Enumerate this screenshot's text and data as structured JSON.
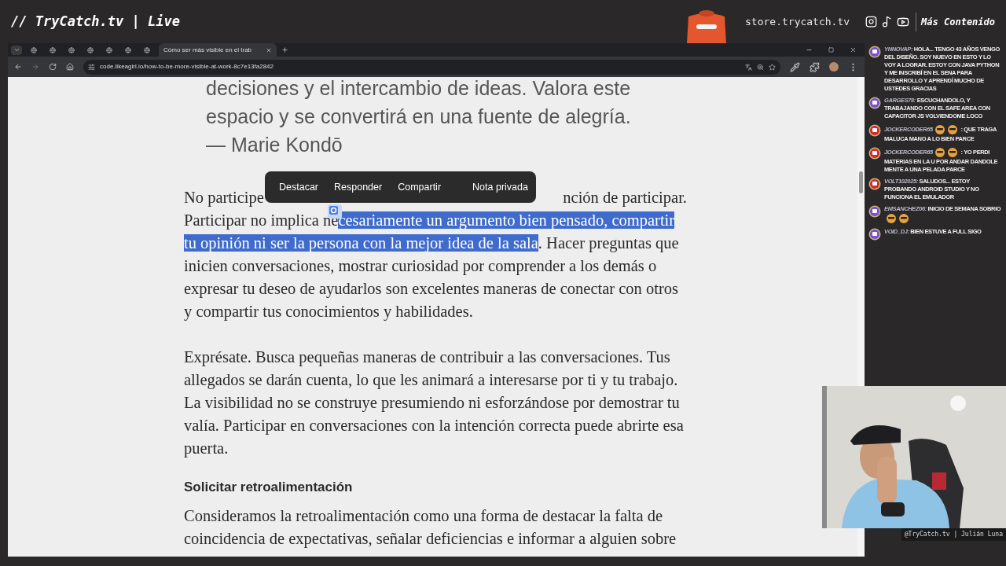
{
  "stream_header": {
    "title": "// TryCatch.tv | Live",
    "store": "store.trycatch.tv",
    "more": "Más Contenido"
  },
  "browser": {
    "tabs": [
      {
        "kind": "dropdown",
        "selected": false
      },
      {
        "kind": "site",
        "selected": false
      },
      {
        "kind": "site",
        "selected": false
      },
      {
        "kind": "site",
        "selected": false
      },
      {
        "kind": "site",
        "selected": false
      },
      {
        "kind": "site",
        "selected": false
      },
      {
        "kind": "site",
        "selected": false
      },
      {
        "kind": "site",
        "selected": false
      },
      {
        "kind": "page",
        "title": "Cómo ser más visible en el trab",
        "selected": true
      }
    ],
    "url": "code.likeagirl.io/how-to-be-more-visible-at-work-8c7e13fa2842"
  },
  "article": {
    "quote_lines": [
      "decisiones y el intercambio de ideas. Valora este",
      "espacio y se convertirá en una fuente de alegría.",
      "— Marie Kondō"
    ],
    "paragraph_1": {
      "start": "No participe",
      "end": "nción de participar.",
      "before": "Participar no implica ne",
      "highlighted": "cesariamente un argumento bien pensado, compartir tu opinión ni ser la persona con la mejor idea de la sala",
      "after": ". Hacer preguntas que inicien conversaciones, mostrar curiosidad por comprender a los demás o expresar tu deseo de ayudarlos son excelentes maneras de conectar con otros y compartir tus conocimientos y habilidades."
    },
    "paragraph_2": "Exprésate. Busca pequeñas maneras de contribuir a las conversaciones. Tus allegados se darán cuenta, lo que les animará a interesarse por ti y tu trabajo. La visibilidad no se construye presumiendo ni esforzándose por demostrar tu valía. Participar en conversaciones con la intención correcta puede abrirte esa puerta.",
    "heading": "Solicitar retroalimentación",
    "paragraph_3": "Consideramos la retroalimentación como una forma de destacar la falta de coincidencia de expectativas, señalar deficiencias e informar a alguien sobre"
  },
  "selection_toolbar": [
    "Destacar",
    "Responder",
    "Compartir",
    "Nota privada"
  ],
  "chat": [
    {
      "kind": "twitch",
      "user": "YNNOVAP:",
      "text": "HOLA... TENGO 43 AÑOS VENGO DEL DISEÑO. SOY NUEVO EN ESTO Y LO VOY A LOGRAR. ESTOY CON JAVA PYTHON Y ME INSCRIBÍ EN EL SENA PARA DESARROLLO Y APRENDÍ MUCHO DE USTEDES GRACIAS",
      "emotes_after_user": false,
      "emotes_after_text": false
    },
    {
      "kind": "twitch",
      "user": "GARGES78:",
      "text": "ESCUCHANDOLO, Y TRABAJANDO CON EL SAFE AREA CON CAPACITOR JS VOLVIENDOME LOCO",
      "emotes_after_user": false,
      "emotes_after_text": false
    },
    {
      "kind": "youtube",
      "user": "JOCKERCODER65",
      "text": ": QUE TRAGA MALUCA MANO A LO BIEN PARCE",
      "emotes_after_user": true,
      "emotes_after_text": false
    },
    {
      "kind": "youtube",
      "user": "JOCKERCODER65",
      "text": ": YO PERDI MATERIAS EN LA U POR ANDAR DANDOLE MENTE A UNA PELADA PARCE",
      "emotes_after_user": true,
      "emotes_after_text": false
    },
    {
      "kind": "youtube",
      "user": "VOLT102025:",
      "text": "SALUDOS... ESTOY PROBANDO ANDROID STUDIO Y NO FUNCIONA EL EMULADOR",
      "emotes_after_user": false,
      "emotes_after_text": false
    },
    {
      "kind": "twitch",
      "user": "EMSANCHEZ06:",
      "text": "INICIO DE SEMANA SOBRIO",
      "emotes_after_user": false,
      "emotes_after_text": true
    },
    {
      "kind": "twitch",
      "user": "VOID_DJ:",
      "text": "BIEN ESTUVE A FULL SIGO",
      "emotes_after_user": false,
      "emotes_after_text": false
    }
  ],
  "webcam": {
    "caption": "@TryCatch.tv | Julián Luna"
  }
}
